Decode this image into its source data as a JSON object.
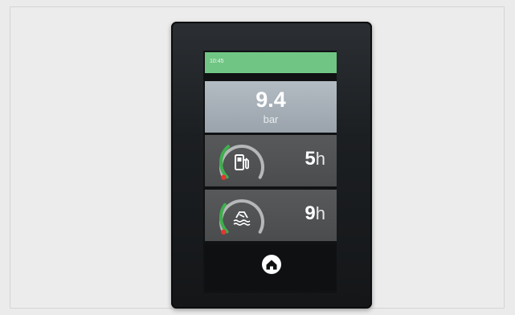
{
  "status": {
    "time": "10:45"
  },
  "pressure": {
    "value": "9.4",
    "unit": "bar"
  },
  "fuel": {
    "hours": "5",
    "unit": "h",
    "icon": "fuel-pump-icon",
    "level": 0.35
  },
  "tank": {
    "hours": "9",
    "unit": "h",
    "icon": "water-tank-icon",
    "level": 0.3
  },
  "nav": {
    "home_icon": "home-icon"
  },
  "colors": {
    "status_bar": "#71c584",
    "gauge_fill": "#3fae4d",
    "gauge_track": "#b5b7b9",
    "gauge_alert": "#e2382f"
  }
}
